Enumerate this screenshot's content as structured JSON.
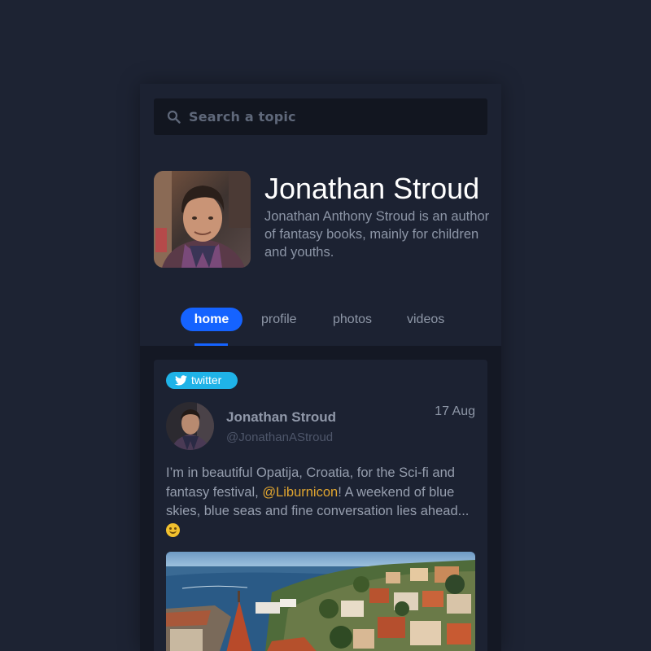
{
  "search": {
    "placeholder": "Search a topic",
    "icon": "search-icon"
  },
  "profile": {
    "name": "Jonathan Stroud",
    "bio": "Jonathan Anthony Stroud is an author of fantasy books, mainly for children and youths."
  },
  "tabs": [
    {
      "label": "home",
      "active": true
    },
    {
      "label": "profile",
      "active": false
    },
    {
      "label": "photos",
      "active": false
    },
    {
      "label": "videos",
      "active": false
    }
  ],
  "post": {
    "source": "twitter",
    "author": "Jonathan Stroud",
    "handle": "@JonathanAStroud",
    "date": "17 Aug",
    "text_before": "I’m in beautiful Opatija, Croatia, for the Sci-fi and fantasy festival, ",
    "mention": "@Liburnicon",
    "text_after": "! A weekend of blue skies, blue seas and fine conversation lies ahead...",
    "emoji": "smiling-face"
  },
  "colors": {
    "background": "#1d2333",
    "panel": "#1c2232",
    "accent": "#1563ff",
    "twitter": "#1fb3e8",
    "mention": "#e0a530"
  }
}
